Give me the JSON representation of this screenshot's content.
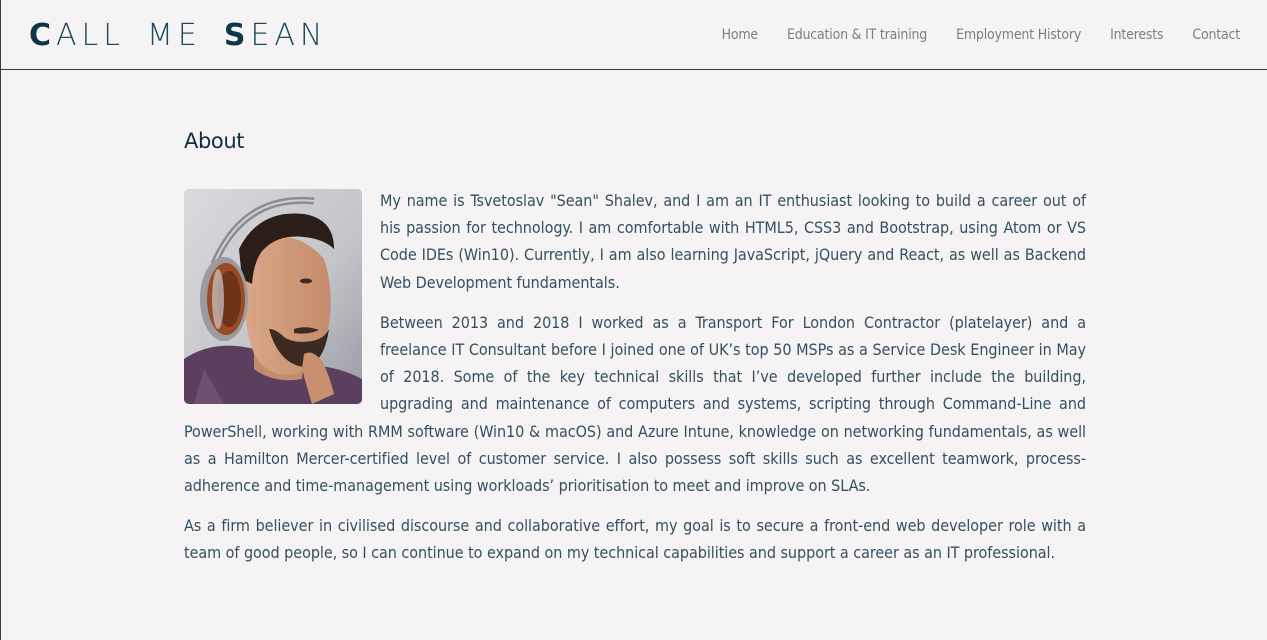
{
  "brand": {
    "word1_cap": "C",
    "word1_rest": "ALL",
    "word2": "ME",
    "word3_cap": "S",
    "word3_rest": "EAN"
  },
  "nav": {
    "items": [
      {
        "label": "Home"
      },
      {
        "label": "Education & IT training"
      },
      {
        "label": "Employment History"
      },
      {
        "label": "Interests"
      },
      {
        "label": "Contact"
      }
    ]
  },
  "about": {
    "title": "About",
    "paragraphs": [
      "My name is Tsvetoslav \"Sean\" Shalev, and I am an IT enthusiast looking to build a career out of his passion for technology. I am comfortable with HTML5, CSS3 and Bootstrap, using Atom or VS Code IDEs (Win10). Currently, I am also learning JavaScript, jQuery and React, as well as Backend Web Development fundamentals.",
      "Between 2013 and 2018 I worked as a Transport For London Contractor (platelayer) and a freelance IT Consultant before I joined one of UK’s top 50 MSPs as a Service Desk Engineer in May of 2018. Some of the key technical skills that I’ve developed further include the building, upgrading and maintenance of computers and systems, scripting through Command-Line and PowerShell, working with RMM software (Win10 & macOS) and Azure Intune, knowledge on networking fundamentals, as well as a Hamilton Mercer-certified level of customer service. I also possess soft skills such as excellent teamwork, process-adherence and time-management using workloads’ prioritisation to meet and improve on SLAs.",
      "As a firm believer in civilised discourse and collaborative effort, my goal is to secure a front-end web developer role with a team of good people, so I can continue to expand on my technical capabilities and support a career as an IT professional."
    ]
  },
  "colors": {
    "background": "#f5f3f4",
    "brand": "#0f3548",
    "nav_text": "#7f7f7f",
    "body_text": "#35505f"
  }
}
